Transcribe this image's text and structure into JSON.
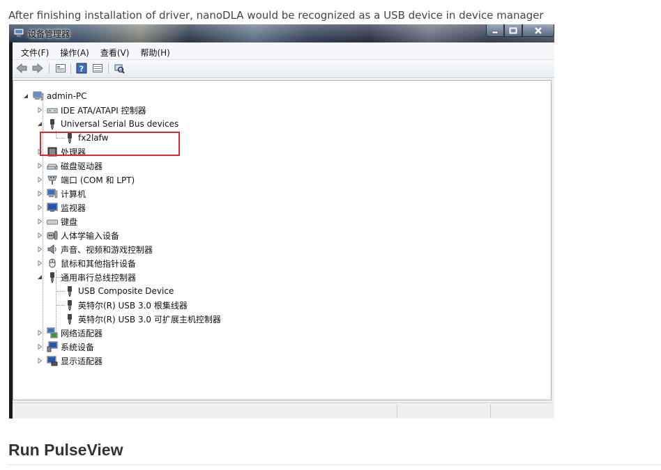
{
  "caption": "After finishing installation of driver, nanoDLA would be recognized as a USB device in device manager",
  "heading": "Run PulseView",
  "window": {
    "title": "设备管理器",
    "menu": [
      "文件(F)",
      "操作(A)",
      "查看(V)",
      "帮助(H)"
    ],
    "toolbar_icons": [
      "back-icon",
      "forward-icon",
      "properties-icon",
      "help-icon",
      "view-icon",
      "scan-hardware-icon"
    ]
  },
  "tree": {
    "root": "admin-PC",
    "categories": [
      {
        "label": "IDE ATA/ATAPI 控制器",
        "icon": "disk-controller-icon",
        "expanded": false
      },
      {
        "label": "Universal Serial Bus devices",
        "icon": "usb-plug-icon",
        "expanded": true,
        "children": [
          "fx2lafw"
        ]
      },
      {
        "label": "处理器",
        "icon": "cpu-icon",
        "expanded": false
      },
      {
        "label": "磁盘驱动器",
        "icon": "disk-drive-icon",
        "expanded": false
      },
      {
        "label": "端口 (COM 和 LPT)",
        "icon": "port-icon",
        "expanded": false
      },
      {
        "label": "计算机",
        "icon": "computer-icon",
        "expanded": false
      },
      {
        "label": "监视器",
        "icon": "monitor-icon",
        "expanded": false
      },
      {
        "label": "键盘",
        "icon": "keyboard-icon",
        "expanded": false
      },
      {
        "label": "人体学输入设备",
        "icon": "hid-icon",
        "expanded": false
      },
      {
        "label": "声音、视频和游戏控制器",
        "icon": "speaker-icon",
        "expanded": false
      },
      {
        "label": "鼠标和其他指针设备",
        "icon": "mouse-icon",
        "expanded": false
      },
      {
        "label": "通用串行总线控制器",
        "icon": "usb-plug-icon",
        "expanded": true,
        "children": [
          "USB Composite Device",
          "英特尔(R) USB 3.0 根集线器",
          "英特尔(R) USB 3.0 可扩展主机控制器"
        ]
      },
      {
        "label": "网络适配器",
        "icon": "network-icon",
        "expanded": false
      },
      {
        "label": "系统设备",
        "icon": "system-device-icon",
        "expanded": false
      },
      {
        "label": "显示适配器",
        "icon": "display-adapter-icon",
        "expanded": false
      }
    ]
  },
  "colors": {
    "highlight": "#e0252c",
    "tree_background": "#ffffff",
    "chrome": "#f0f0f0"
  }
}
